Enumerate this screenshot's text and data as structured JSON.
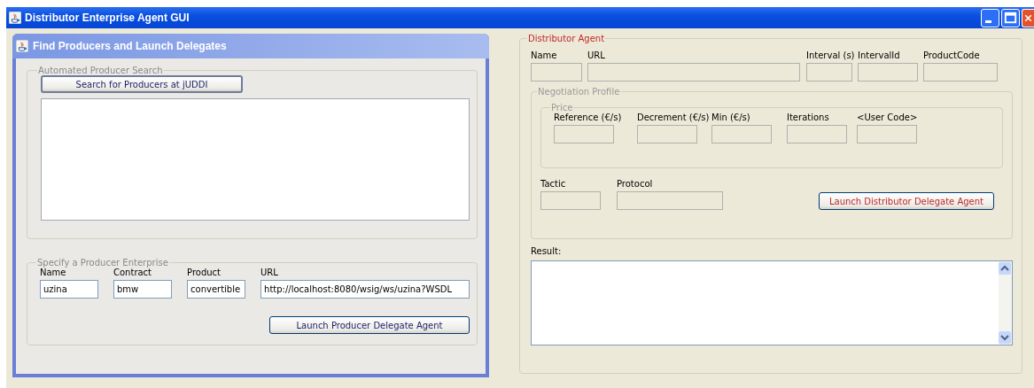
{
  "window": {
    "title": "Distributor Enterprise Agent GUI"
  },
  "producer_frame": {
    "title": "Find Producers and Launch Delegates",
    "search_group": {
      "title": "Automated Producer Search",
      "button": "Search for Producers at jUDDI"
    },
    "specify_group": {
      "title": "Specify a  Producer Enterprise",
      "fields": [
        {
          "label": "Name",
          "value": "uzina"
        },
        {
          "label": "Contract",
          "value": "bmw"
        },
        {
          "label": "Product",
          "value": "convertible"
        },
        {
          "label": "URL",
          "value": "http://localhost:8080/wsig/ws/uzina?WSDL"
        }
      ],
      "button": "Launch Producer Delegate Agent"
    }
  },
  "distributor_group": {
    "title": "Distributor Agent",
    "fields": [
      {
        "label": "Name",
        "disabled": true
      },
      {
        "label": "URL",
        "disabled": true
      },
      {
        "label": "Interval (s)",
        "disabled": true
      },
      {
        "label": "IntervalId",
        "disabled": true
      },
      {
        "label": "ProductCode",
        "disabled": true
      }
    ],
    "negotiation_profile": {
      "title": "Negotiation Profile",
      "price": {
        "title": "Price",
        "fields": [
          {
            "label": "Reference (€/s)",
            "disabled": true
          },
          {
            "label": "Decrement (€/s)",
            "disabled": true
          },
          {
            "label": "Min  (€/s)",
            "disabled": true
          },
          {
            "label": "Iterations",
            "disabled": true
          },
          {
            "label": "<User Code>",
            "disabled": true
          }
        ]
      },
      "fields": [
        {
          "label": "Tactic",
          "disabled": true
        },
        {
          "label": "Protocol",
          "disabled": true
        }
      ],
      "button": "Launch Distributor Delegate Agent"
    },
    "result": {
      "label": "Result:"
    }
  }
}
